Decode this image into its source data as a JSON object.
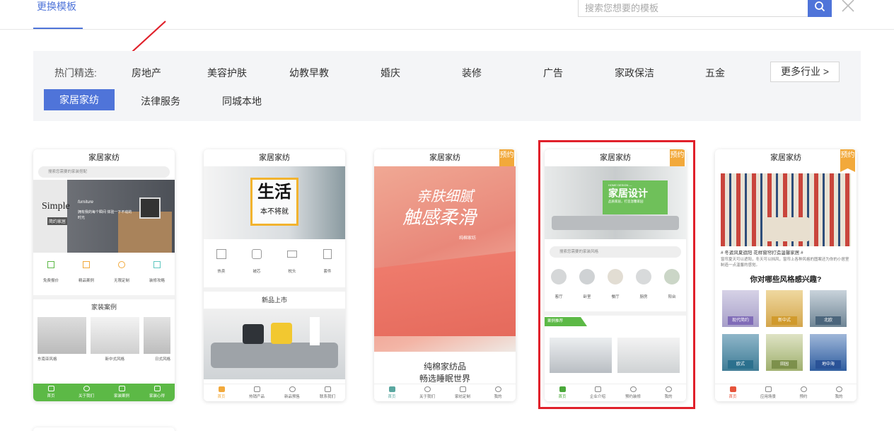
{
  "header": {
    "tab_label": "更换模板",
    "search_placeholder": "搜索您想要的模板"
  },
  "filter": {
    "label": "热门精选:",
    "row1": [
      "房地产",
      "美容护肤",
      "幼教早教",
      "婚庆",
      "装修",
      "广告",
      "家政保洁",
      "五金"
    ],
    "more_label": "更多行业 >",
    "active": "家居家纺",
    "row2": [
      "法律服务",
      "同城本地"
    ]
  },
  "badge_text": "预约",
  "cards": [
    {
      "title": "家居家纺",
      "search": "搜索您需要的家装搭配",
      "hero_text1": "Simple",
      "hero_text2": "furniture",
      "hero_text3": "简约家居",
      "hero_text4": "拥有我的每个瞬间 体验一下不动的时光",
      "services": [
        "免费报价",
        "精品案例",
        "无限定制",
        "装修攻略"
      ],
      "section": "家装案例",
      "cases": [
        "东南亚风格",
        "新中式风格",
        "日式风格"
      ],
      "tabs": [
        "首页",
        "关于我们",
        "家装案例",
        "家装心得"
      ]
    },
    {
      "title": "家居家纺",
      "hero_big": "生活",
      "hero_small": "本不将就",
      "cats": [
        "热卖",
        "被芯",
        "枕头",
        "套件"
      ],
      "section": "新品上市",
      "tabs": [
        "首页",
        "热销产品",
        "新品预售",
        "联系我们"
      ]
    },
    {
      "title": "家居家纺",
      "hero_line1": "亲肤细腻",
      "hero_line2": "触感柔滑",
      "hero_tag": "纯棉家纺",
      "bottom1": "纯棉家纺品",
      "bottom2": "畅选睡眠世界",
      "tabs": [
        "首页",
        "关于我们",
        "家纺定制",
        "我的"
      ]
    },
    {
      "title": "家居家纺",
      "hero_small": "HOME DESIGN —",
      "hero_big": "家居设计",
      "hero_sub": "品质家居，打造温馨家园",
      "search": "搜索您需要的家装风格",
      "rooms": [
        "客厅",
        "卧室",
        "餐厅",
        "厨房",
        "阳台"
      ],
      "section": "案例推荐",
      "tabs": [
        "首页",
        "企业介绍",
        "预约装修",
        "我的"
      ]
    },
    {
      "title": "家居家纺",
      "headline": "# 冬遮风夏遮阳 花样窗帘打造温馨家居 #",
      "desc": "窗帘夏天可以遮阳，冬天可以挡风，窗帘上各种风格的图案还为你的小居室制造一点温馨的感觉。",
      "question": "你对哪些风格感兴趣?",
      "styles": [
        "现代简约",
        "新中式",
        "北欧",
        "欧式",
        "田园",
        "地中海"
      ],
      "tabs": [
        "首页",
        "应用场景",
        "预约",
        "我的"
      ]
    }
  ],
  "colors": {
    "accent": "#4f74d9",
    "green": "#5cb946",
    "badge": "#f2a93b",
    "red": "#e0202a"
  }
}
